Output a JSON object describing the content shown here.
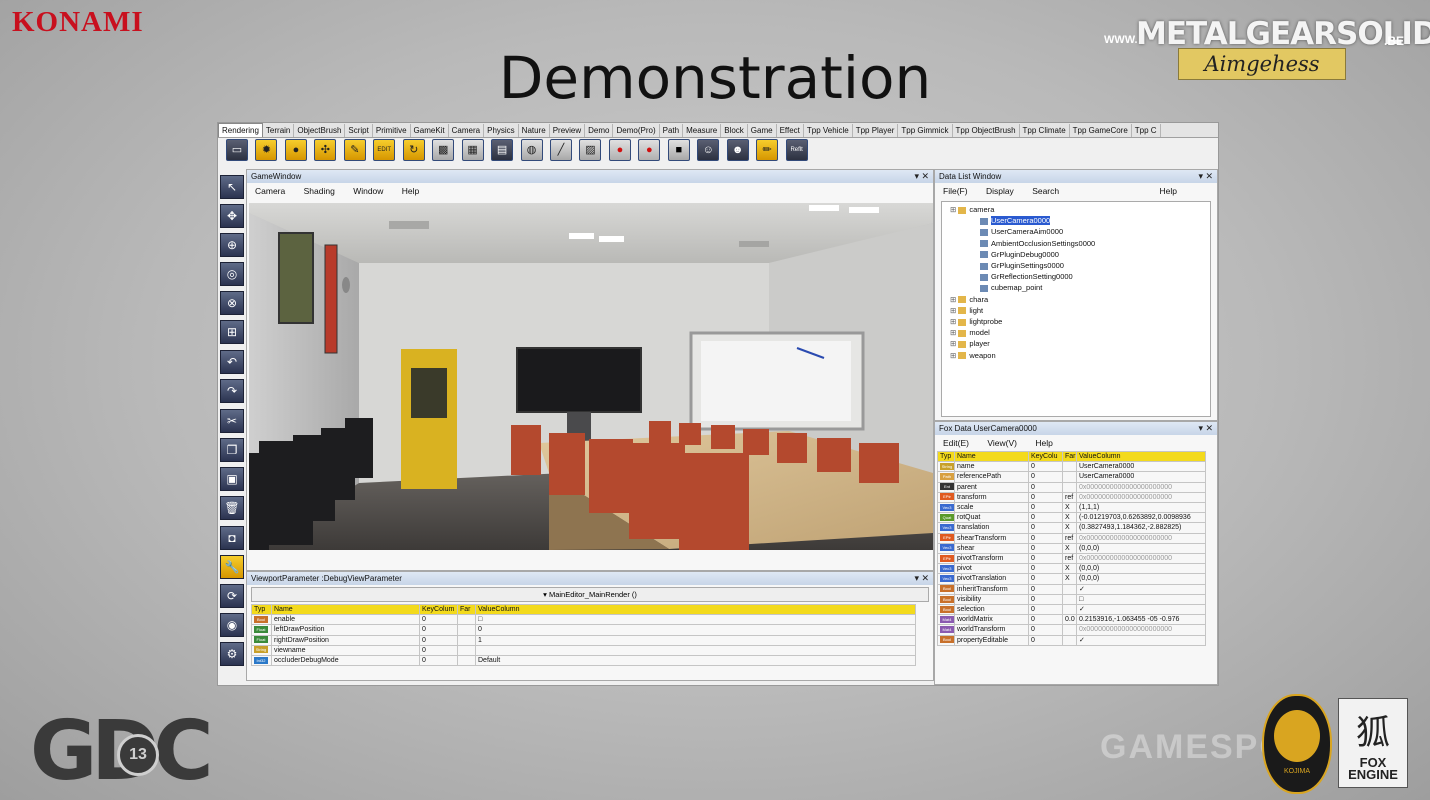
{
  "slide": {
    "brand": "KONAMI",
    "title": "Demonstration",
    "mgs_logo": {
      "www": "WWW.",
      "name": "METALGEARSOLID",
      "tld": ".BE",
      "sub": "Aimgehess"
    },
    "gdc": {
      "text": "GDC",
      "year": "13"
    },
    "kojima_logo": "KOJIMA",
    "fox_logo": {
      "glyph": "狐",
      "text": "FOX\nENGINE"
    },
    "watermark": "GAMESPOT",
    "colors": {
      "konami_red": "#c8101e",
      "accent_yellow": "#f3da1c",
      "selection_blue": "#2a5ad0"
    }
  },
  "editor": {
    "tabs": [
      "Rendering",
      "Terrain",
      "ObjectBrush",
      "Script",
      "Primitive",
      "GameKit",
      "Camera",
      "Physics",
      "Nature",
      "Preview",
      "Demo",
      "Demo(Pro)",
      "Path",
      "Measure",
      "Block",
      "Game",
      "Effect",
      "Tpp Vehicle",
      "Tpp Player",
      "Tpp Gimmick",
      "Tpp ObjectBrush",
      "Tpp Climate",
      "Tpp GameCore",
      "Tpp C"
    ],
    "toolbar_last_label": "Reflt",
    "game_window": {
      "title": "GameWindow",
      "menu": [
        "Camera",
        "Shading",
        "Window",
        "Help"
      ]
    },
    "viewport_param": {
      "title": "ViewportParameter :DebugViewParameter",
      "subheader": "MainEditor_MainRender ()",
      "columns": [
        "Typ",
        "Name",
        "KeyColum",
        "Far",
        "ValueColumn"
      ],
      "rows": [
        {
          "type": "Bool",
          "name": "enable",
          "key": "0",
          "value": "□"
        },
        {
          "type": "Float",
          "name": "leftDrawPosition",
          "key": "0",
          "value": "0"
        },
        {
          "type": "Float",
          "name": "rightDrawPosition",
          "key": "0",
          "value": "1"
        },
        {
          "type": "String",
          "name": "viewname",
          "key": "0",
          "value": ""
        },
        {
          "type": "Int32",
          "name": "occluderDebugMode",
          "key": "0",
          "value": "Default"
        }
      ]
    },
    "data_list": {
      "title": "Data List Window",
      "menu": [
        "File(F)",
        "Display",
        "Search",
        "Help"
      ],
      "tree": [
        {
          "label": "camera",
          "level": 0
        },
        {
          "label": "UserCamera0000",
          "level": 1,
          "selected": true
        },
        {
          "label": "UserCameraAim0000",
          "level": 1
        },
        {
          "label": "AmbientOcclusionSettings0000",
          "level": 1
        },
        {
          "label": "GrPluginDebug0000",
          "level": 1
        },
        {
          "label": "GrPluginSettings0000",
          "level": 1
        },
        {
          "label": "GrReflectionSetting0000",
          "level": 1
        },
        {
          "label": "cubemap_point",
          "level": 1
        },
        {
          "label": "chara",
          "level": 0
        },
        {
          "label": "light",
          "level": 0
        },
        {
          "label": "lightprobe",
          "level": 0
        },
        {
          "label": "model",
          "level": 0
        },
        {
          "label": "player",
          "level": 0
        },
        {
          "label": "weapon",
          "level": 0
        }
      ]
    },
    "fox_data": {
      "title": "Fox Data UserCamera0000",
      "menu": [
        "Edit(E)",
        "View(V)",
        "Help"
      ],
      "columns": [
        "Typ",
        "Name",
        "KeyColu",
        "Far",
        "ValueColumn"
      ],
      "rows": [
        {
          "type": "String",
          "name": "name",
          "key": "0",
          "far": "",
          "value": "UserCamera0000"
        },
        {
          "type": "Path",
          "name": "referencePath",
          "key": "0",
          "far": "",
          "value": "UserCamera0000"
        },
        {
          "type": "Ent",
          "name": "parent",
          "key": "0",
          "far": "",
          "value": "0x0000000000000000000000"
        },
        {
          "type": "EPtr",
          "name": "transform",
          "key": "0",
          "far": "ref",
          "value": "0x0000000000000000000000"
        },
        {
          "type": "Vec3",
          "name": "scale",
          "key": "0",
          "far": "X",
          "value": "(1,1,1)"
        },
        {
          "type": "Quat",
          "name": "rotQuat",
          "key": "0",
          "far": "X",
          "value": "(-0.01219703,0.6263892,0.0098936"
        },
        {
          "type": "Vec3",
          "name": "translation",
          "key": "0",
          "far": "X",
          "value": "(0.3827493,1.184362,-2.882825)"
        },
        {
          "type": "EPtr",
          "name": "shearTransform",
          "key": "0",
          "far": "ref",
          "value": "0x0000000000000000000000"
        },
        {
          "type": "Vec3",
          "name": "shear",
          "key": "0",
          "far": "X",
          "value": "(0,0,0)"
        },
        {
          "type": "EPtr",
          "name": "pivotTransform",
          "key": "0",
          "far": "ref",
          "value": "0x0000000000000000000000"
        },
        {
          "type": "Vec3",
          "name": "pivot",
          "key": "0",
          "far": "X",
          "value": "(0,0,0)"
        },
        {
          "type": "Vec3",
          "name": "pivotTranslation",
          "key": "0",
          "far": "X",
          "value": "(0,0,0)"
        },
        {
          "type": "Bool",
          "name": "inheritTransform",
          "key": "0",
          "far": "",
          "value": "✓"
        },
        {
          "type": "Bool",
          "name": "visibility",
          "key": "0",
          "far": "",
          "value": "□"
        },
        {
          "type": "Bool",
          "name": "selection",
          "key": "0",
          "far": "",
          "value": "✓"
        },
        {
          "type": "Mat4",
          "name": "worldMatrix",
          "key": "0",
          "far": "0.0",
          "value": "0.2153916,-1.063455 -05 -0.976"
        },
        {
          "type": "Mat4",
          "name": "worldTransform",
          "key": "0",
          "far": "",
          "value": "0x0000000000000000000000"
        },
        {
          "type": "Bool",
          "name": "propertyEditable",
          "key": "0",
          "far": "",
          "value": "✓"
        }
      ]
    }
  }
}
